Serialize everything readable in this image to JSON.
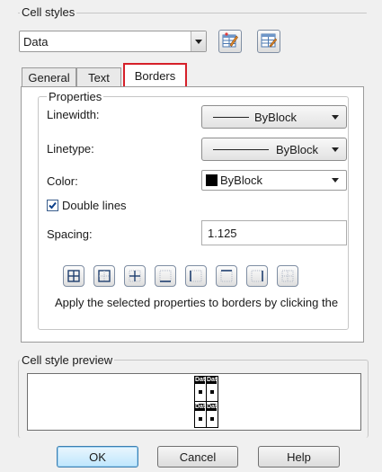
{
  "cell_styles": {
    "title": "Cell styles",
    "selected_style": "Data"
  },
  "tabs": [
    {
      "label": "General"
    },
    {
      "label": "Text"
    },
    {
      "label": "Borders"
    }
  ],
  "properties": {
    "title": "Properties",
    "linewidth_label": "Linewidth:",
    "linewidth_value": "ByBlock",
    "linetype_label": "Linetype:",
    "linetype_value": "ByBlock",
    "color_label": "Color:",
    "color_value": "ByBlock",
    "color_swatch": "#000000",
    "double_lines_label": "Double lines",
    "double_lines_checked": true,
    "spacing_label": "Spacing:",
    "spacing_value": "1.125",
    "hint": "Apply the selected properties to borders by clicking the"
  },
  "border_buttons": [
    {
      "icon": "all-borders-icon"
    },
    {
      "icon": "outside-borders-icon"
    },
    {
      "icon": "inside-borders-icon"
    },
    {
      "icon": "bottom-border-icon"
    },
    {
      "icon": "left-border-icon"
    },
    {
      "icon": "top-border-icon"
    },
    {
      "icon": "right-border-icon"
    },
    {
      "icon": "no-border-icon"
    }
  ],
  "preview": {
    "title": "Cell style preview",
    "cell_text": "Dat"
  },
  "buttons": {
    "ok": "OK",
    "cancel": "Cancel",
    "help": "Help"
  },
  "colors": {
    "highlight_border": "#d6202a",
    "default_button": "#3c7fb1"
  }
}
